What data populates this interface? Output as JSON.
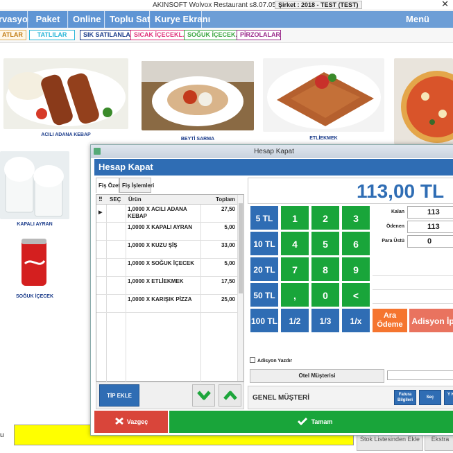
{
  "window": {
    "title": "AKINSOFT Wolvox Restaurant s8.07.05",
    "company": "Şirket : 2018 - TEST (TEST)"
  },
  "menubar": {
    "items": [
      "rvasyon",
      "Paket",
      "Online",
      "Toplu Satış",
      "Kurye Ekranı"
    ],
    "right": "Menü"
  },
  "categories": [
    "ATLAR",
    "TATLILAR",
    "SIK SATILANLAR",
    "SICAK İÇECEKL...",
    "SOĞUK İÇECEK...",
    "PİRZOLALAR"
  ],
  "products": [
    {
      "name": "ACILI ADANA KEBAP"
    },
    {
      "name": "BEYTİ SARMA"
    },
    {
      "name": "ETLİEKMEK"
    },
    {
      "name": "KAPALI AYRAN"
    },
    {
      "name": "SOĞUK İÇECEK"
    }
  ],
  "footer": {
    "prefix": "u",
    "btn1": "Stok Listesinden Ekle",
    "btn2": "Ekstra"
  },
  "dialog": {
    "title": "Hesap Kapat",
    "header": "Hesap Kapat",
    "tabs": [
      "Fiş Özeti",
      "Fiş İşlemleri"
    ],
    "columns": {
      "sec": "SEÇ",
      "urun": "Ürün",
      "toplam": "Toplam"
    },
    "items": [
      {
        "urun": "1,0000 X ACILI ADANA KEBAP",
        "toplam": "27,50"
      },
      {
        "urun": "1,0000 X KAPALI AYRAN",
        "toplam": "5,00"
      },
      {
        "urun": "1,0000 X KUZU ŞİŞ",
        "toplam": "33,00"
      },
      {
        "urun": "1,0000 X SOĞUK İÇECEK",
        "toplam": "5,00"
      },
      {
        "urun": "1,0000 X ETLİEKMEK",
        "toplam": "17,50"
      },
      {
        "urun": "1,0000 X KARIŞIK PİZZA",
        "toplam": "25,00"
      }
    ],
    "tip_ekle": "TİP EKLE",
    "total": "113,00 TL",
    "keys": {
      "money": [
        "5 TL",
        "10 TL",
        "20 TL",
        "50 TL",
        "100 TL"
      ],
      "digits": [
        "1",
        "2",
        "3",
        "4",
        "5",
        "6",
        "7",
        "8",
        "9",
        ",",
        "0",
        "<"
      ],
      "fractions": [
        "1/2",
        "1/3",
        "1/x"
      ],
      "ara_odeme": "Ara Ödeme",
      "adisyon": "Adisyon İp"
    },
    "summary": {
      "kalan_label": "Kalan",
      "kalan": "113",
      "odenen_label": "Ödenen",
      "odenen": "113",
      "para_ustu_label": "Para Üstü",
      "para_ustu": "0"
    },
    "adisyon_yazdir": "Adisyon Yazdır",
    "otel": "Otel Müşterisi",
    "musteri": "GENEL MÜŞTERİ",
    "fatura": "Fatura Bilgileri",
    "sec": "Seç",
    "yeni": "Y K",
    "vazgec": "Vazgeç",
    "tamam": "Tamam",
    "colors": {
      "blue": "#2f6db4",
      "green": "#19a53a",
      "orange": "#f5752f",
      "red": "#d9453a"
    }
  }
}
